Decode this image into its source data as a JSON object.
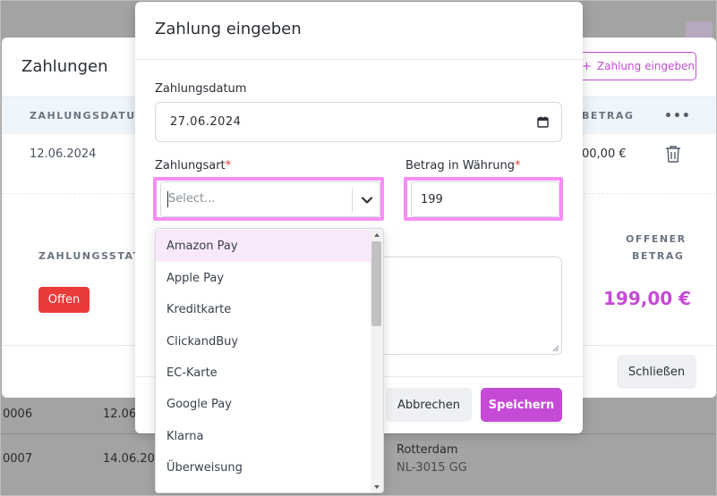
{
  "background_rows": [
    {
      "id": "0006",
      "date": "12.06.",
      "city": "",
      "zip": ""
    },
    {
      "id": "0007",
      "date": "14.06.202",
      "city": "Rotterdam",
      "zip": "NL-3015 GG"
    }
  ],
  "zahlungen_modal": {
    "title": "Zahlungen",
    "add_button": "Zahlung eingeben",
    "columns": {
      "date": "ZAHLUNGSDATUM",
      "amount": "BETRAG"
    },
    "row": {
      "date": "12.06.2024",
      "amount": "00,00 €"
    },
    "summary": {
      "status_header": "ZAHLUNGSSTATUS",
      "open_header_line1": "OFFENER",
      "open_header_line2": "BETRAG",
      "status": "Offen",
      "open_amount": "199,00 €"
    },
    "close_button": "Schließen"
  },
  "payment_modal": {
    "title": "Zahlung eingeben",
    "date_label": "Zahlungsdatum",
    "date_value": "27.06.2024",
    "method_label": "Zahlungsart",
    "method_placeholder": "Select...",
    "amount_label": "Betrag in Währung",
    "amount_value": "199",
    "required_mark": "*",
    "cancel_button": "Abbrechen",
    "save_button": "Speichern"
  },
  "dropdown_options": [
    "Amazon Pay",
    "Apple Pay",
    "Kreditkarte",
    "ClickandBuy",
    "EC-Karte",
    "Google Pay",
    "Klarna",
    "Überweisung"
  ],
  "colors": {
    "accent": "#c54ad6",
    "danger": "#ea3a3a",
    "highlight": "#f68ef5",
    "active_option_bg": "#f9e8fb"
  }
}
